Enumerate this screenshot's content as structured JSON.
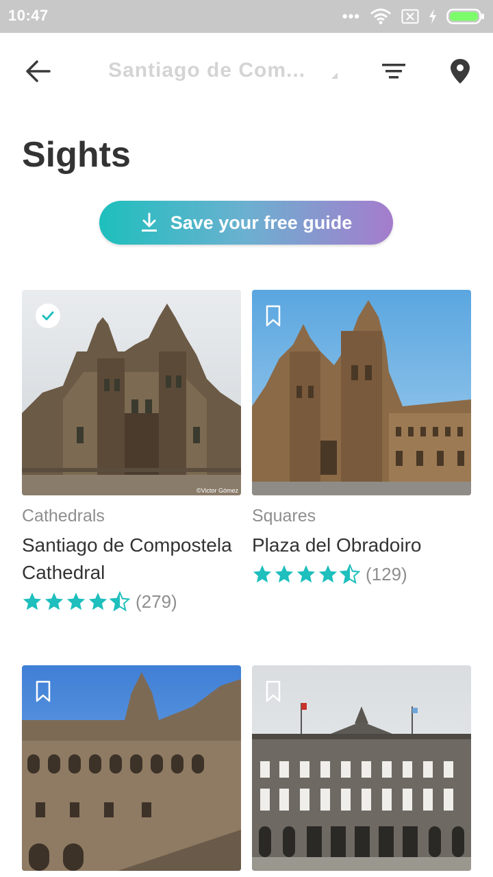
{
  "status_bar": {
    "time": "10:47",
    "icons": [
      "more-dots-icon",
      "wifi-icon",
      "sim-off-icon",
      "charging-icon",
      "battery-icon"
    ]
  },
  "header": {
    "title": "Santiago de Com...",
    "icons": [
      "back-arrow-icon",
      "dropdown-caret-icon",
      "filter-icon",
      "map-pin-icon"
    ]
  },
  "page": {
    "heading": "Sights"
  },
  "save_button": {
    "label": "Save your free guide",
    "icon": "download-icon",
    "gradient": [
      "#1ebfbd",
      "#a57ccd"
    ]
  },
  "accent_color": "#1ebfbd",
  "cards": [
    {
      "category": "Cathedrals",
      "name": "Santiago de Compostela Cathedral",
      "rating": 4.5,
      "count": "(279)",
      "saved": true,
      "photo_credit": "©Victor Gómez"
    },
    {
      "category": "Squares",
      "name": "Plaza del Obradoiro",
      "rating": 4.5,
      "count": "(129)",
      "saved": false
    },
    {
      "saved": false
    },
    {
      "saved": false
    }
  ]
}
